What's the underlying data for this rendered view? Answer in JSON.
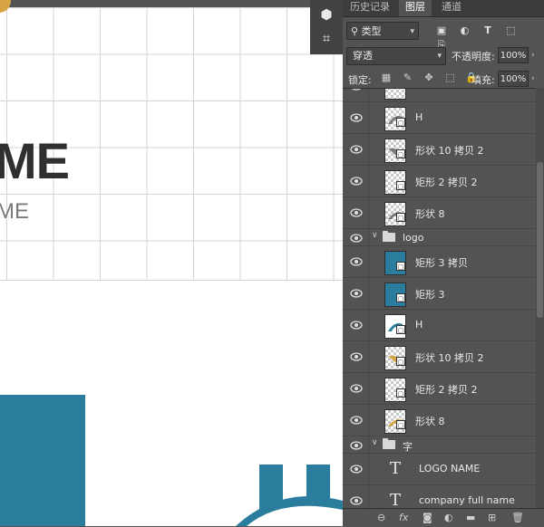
{
  "canvas": {
    "big_title": "ME",
    "sub_title": "ME"
  },
  "colors": {
    "brand_blue": "#2a7d9c",
    "brand_gold": "#d8a545"
  },
  "panel": {
    "tabs": [
      {
        "label": "历史记录",
        "active": false
      },
      {
        "label": "图层",
        "active": true
      },
      {
        "label": "通道",
        "active": false
      }
    ],
    "filter": {
      "label": "类型",
      "icons": [
        "image-filter-icon",
        "adjustment-filter-icon",
        "type-filter-icon",
        "shape-filter-icon",
        "smart-object-filter-icon"
      ]
    },
    "blend_mode": "穿透",
    "opacity_label": "不透明度:",
    "opacity_value": "100%",
    "lock_label": "锁定:",
    "fill_label": "填充:",
    "fill_value": "100%",
    "layers": [
      {
        "kind": "shape",
        "name": "H",
        "thumb": "checker-gray"
      },
      {
        "kind": "shape",
        "name": "形状 10 拷贝 2",
        "thumb": "checker-gray"
      },
      {
        "kind": "shape",
        "name": "矩形 2 拷贝 2",
        "thumb": "checker"
      },
      {
        "kind": "shape",
        "name": "形状 8",
        "thumb": "checker-gray"
      },
      {
        "kind": "group",
        "name": "logo"
      },
      {
        "kind": "shape",
        "name": "矩形 3 拷贝",
        "thumb": "blue"
      },
      {
        "kind": "shape",
        "name": "矩形 3",
        "thumb": "blue"
      },
      {
        "kind": "shape",
        "name": "H",
        "thumb": "blue"
      },
      {
        "kind": "shape",
        "name": "形状 10 拷贝 2",
        "thumb": "checker-gold"
      },
      {
        "kind": "shape",
        "name": "矩形 2 拷贝 2",
        "thumb": "checker"
      },
      {
        "kind": "shape",
        "name": "形状 8",
        "thumb": "checker-gold"
      },
      {
        "kind": "group",
        "name": "字"
      },
      {
        "kind": "text",
        "name": "LOGO NAME"
      },
      {
        "kind": "text",
        "name": "company full name"
      }
    ]
  }
}
